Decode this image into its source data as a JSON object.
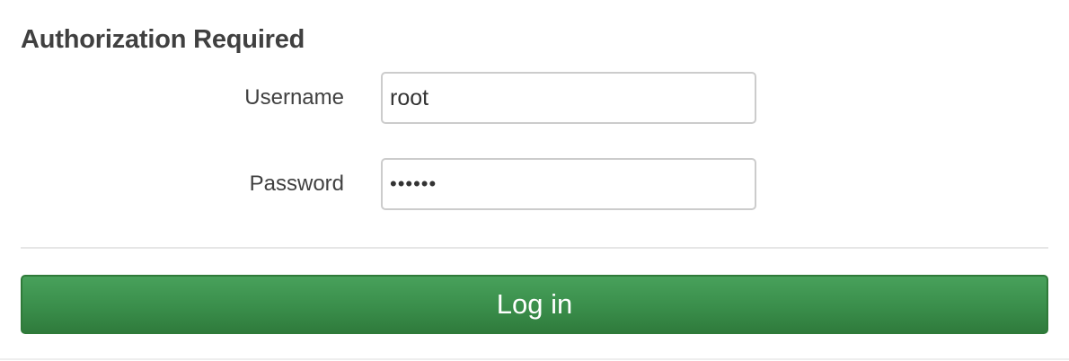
{
  "login": {
    "title": "Authorization Required",
    "username_label": "Username",
    "username_value": "root",
    "password_label": "Password",
    "password_value": "••••••",
    "submit_label": "Log in"
  },
  "colors": {
    "button": "#3a8e4b",
    "text": "#404040",
    "input_border": "#cccccc"
  }
}
